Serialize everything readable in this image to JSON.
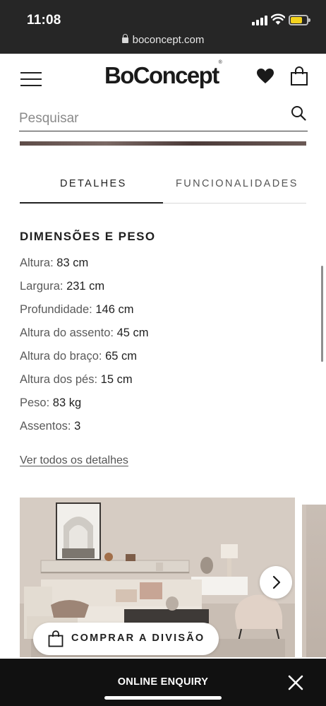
{
  "status_bar": {
    "time": "11:08",
    "url": "boconcept.com",
    "icons": [
      "signal-icon",
      "wifi-icon",
      "battery-icon",
      "lock-icon"
    ]
  },
  "header": {
    "logo": "BoConcept",
    "logo_mark": "®",
    "icons": [
      "menu-icon",
      "heart-icon",
      "shopping-bag-icon"
    ]
  },
  "search": {
    "placeholder": "Pesquisar",
    "icon": "search-icon"
  },
  "tabs": [
    {
      "label": "DETALHES",
      "active": true
    },
    {
      "label": "FUNCIONALIDADES",
      "active": false
    }
  ],
  "dimensions": {
    "title": "DIMENSÕES E PESO",
    "specs": [
      {
        "label": "Altura:",
        "value": "83 cm"
      },
      {
        "label": "Largura:",
        "value": "231 cm"
      },
      {
        "label": "Profundidade:",
        "value": "146 cm"
      },
      {
        "label": "Altura do assento:",
        "value": "45 cm"
      },
      {
        "label": "Altura do braço:",
        "value": "65 cm"
      },
      {
        "label": "Altura dos pés:",
        "value": "15 cm"
      },
      {
        "label": "Peso:",
        "value": "83 kg"
      },
      {
        "label": "Assentos:",
        "value": "3"
      }
    ],
    "more_link": "Ver todos os detalhes"
  },
  "carousel": {
    "shop_room_label": "COMPRAR A DIVISÃO",
    "icons": [
      "chevron-right-icon",
      "shopping-bag-icon"
    ]
  },
  "footer": {
    "enquiry_label": "ONLINE ENQUIRY",
    "close_icon": "close-icon"
  },
  "colors": {
    "status_bar_bg": "#262626",
    "enquiry_bar_bg": "#111111",
    "battery": "#f3d21d",
    "text_primary": "#1f1f1f",
    "text_secondary": "#5a5a5a"
  }
}
